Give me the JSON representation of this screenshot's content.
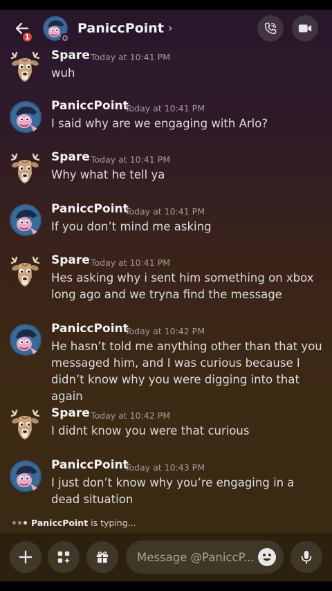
{
  "header": {
    "back_badge": "1",
    "title": "PaniccPoint",
    "chevron": "›",
    "call_icon": "phone-call-icon",
    "video_icon": "video-camera-icon"
  },
  "messages": [
    {
      "author": "Spare",
      "time": "Today at 10:41 PM",
      "text": "wuh",
      "avatar": "spare"
    },
    {
      "author": "PaniccPoint",
      "time": "Today at 10:41 PM",
      "text": "I said why are we engaging with Arlo?",
      "avatar": "panicc"
    },
    {
      "author": "Spare",
      "time": "Today at 10:41 PM",
      "text": "Why what he tell ya",
      "avatar": "spare"
    },
    {
      "author": "PaniccPoint",
      "time": "Today at 10:41 PM",
      "text": "If you don’t mind me asking",
      "avatar": "panicc"
    },
    {
      "author": "Spare",
      "time": "Today at 10:41 PM",
      "text": "Hes asking why i sent him something on xbox long ago and we tryna find the message",
      "avatar": "spare"
    },
    {
      "author": "PaniccPoint",
      "time": "Today at 10:42 PM",
      "text": "He hasn’t told me anything other than that you messaged him, and I was curious because I didn’t know why you were digging into that again",
      "avatar": "panicc"
    },
    {
      "author": "Spare",
      "time": "Today at 10:42 PM",
      "text": "I didnt know you were that curious",
      "avatar": "spare"
    },
    {
      "author": "PaniccPoint",
      "time": "Today at 10:43 PM",
      "text": "I just don’t know why you’re engaging in a dead situation",
      "avatar": "panicc"
    }
  ],
  "typing": {
    "user": "PaniccPoint",
    "suffix": " is typing..."
  },
  "composer": {
    "placeholder": "Message @PaniccP...",
    "plus_icon": "plus-icon",
    "apps_icon": "apps-icon",
    "gift_icon": "gift-icon",
    "emoji_icon": "emoji-icon",
    "mic_icon": "microphone-icon"
  },
  "colors": {
    "badge": "#e23d3d",
    "panicc_avatar_bg": "#2f5a86",
    "spare_fur": "#c9a27a"
  }
}
